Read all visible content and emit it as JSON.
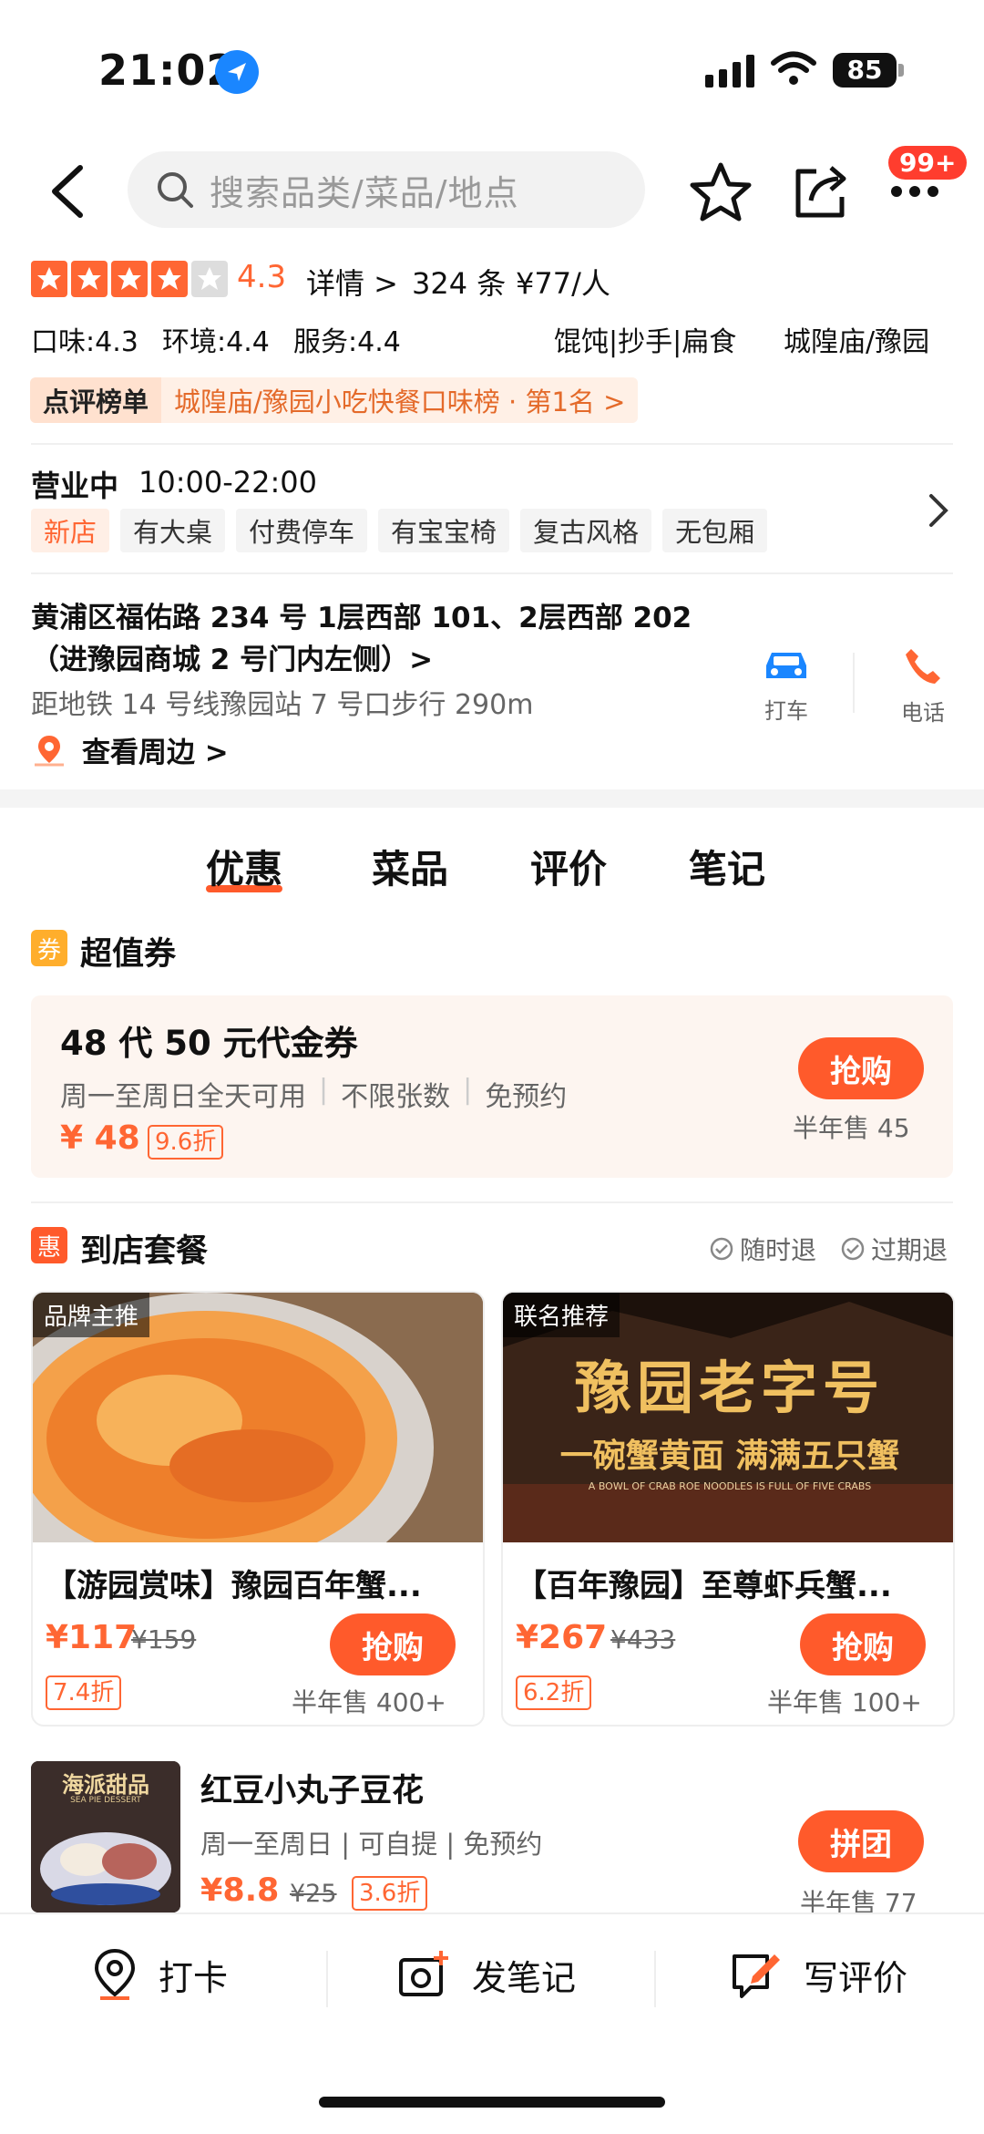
{
  "status": {
    "time": "21:02",
    "battery": "85"
  },
  "header": {
    "search_placeholder": "搜索品类/菜品/地点",
    "badge": "99+"
  },
  "rating": {
    "score": "4.3",
    "detail_link": "详情 >",
    "reviews": "324 条",
    "price": "¥77/人",
    "taste": "口味:4.3",
    "env": "环境:4.4",
    "service": "服务:4.4",
    "category": "馄饨|抄手|扁食",
    "area": "城隍庙/豫园",
    "rank_label": "点评榜单",
    "rank_text": "城隍庙/豫园小吃快餐口味榜 · 第1名 >"
  },
  "hours": {
    "status": "营业中",
    "time": "10:00-22:00",
    "tags": [
      "新店",
      "有大桌",
      "付费停车",
      "有宝宝椅",
      "复古风格",
      "无包厢"
    ]
  },
  "address": {
    "line1": "黄浦区福佑路 234 号 1层西部 101、2层西部 202",
    "line2": "（进豫园商城 2 号门内左侧）>",
    "metro": "距地铁 14 号线豫园站 7 号口步行 290m",
    "nearby": "查看周边 >",
    "taxi_label": "打车",
    "phone_label": "电话"
  },
  "tabs": [
    {
      "label": "优惠"
    },
    {
      "label": "菜品"
    },
    {
      "label": "评价"
    },
    {
      "label": "笔记"
    }
  ],
  "voucher_section": {
    "icon_text": "券",
    "title": "超值券",
    "voucher": {
      "name": "48 代 50 元代金券",
      "cond1": "周一至周日全天可用",
      "cond2": "不限张数",
      "cond3": "免预约",
      "price": "¥ 48",
      "discount": "9.6折",
      "buy_label": "抢购",
      "sold": "半年售 45"
    }
  },
  "package_section": {
    "icon_text": "惠",
    "title": "到店套餐",
    "feat1": "随时退",
    "feat2": "过期退",
    "cards": [
      {
        "badge": "品牌主推",
        "title": "【游园赏味】豫园百年蟹...",
        "price": "¥117",
        "orig": "¥159",
        "discount": "7.4折",
        "buy_label": "抢购",
        "sold": "半年售 400+"
      },
      {
        "badge": "联名推荐",
        "title": "【百年豫园】至尊虾兵蟹...",
        "price": "¥267",
        "orig": "¥433",
        "discount": "6.2折",
        "buy_label": "抢购",
        "sold": "半年售 100+",
        "img_title": "豫园老字号",
        "img_sub": "一碗蟹黄面 满满五只蟹",
        "img_en": "A BOWL OF CRAB ROE NOODLES IS FULL OF FIVE CRABS"
      }
    ]
  },
  "group_item": {
    "img_label": "海派甜品",
    "img_sub": "SEA PIE DESSERT",
    "title": "红豆小丸子豆花",
    "cond": "周一至周日 | 可自提 | 免预约",
    "price": "¥8.8",
    "orig": "¥25",
    "discount": "3.6折",
    "buy_label": "拼团",
    "sold": "半年售 77"
  },
  "bottom_bar": {
    "checkin": "打卡",
    "note": "发笔记",
    "review": "写评价"
  },
  "colors": {
    "accent": "#ff5a2b",
    "star": "#ff6633"
  }
}
